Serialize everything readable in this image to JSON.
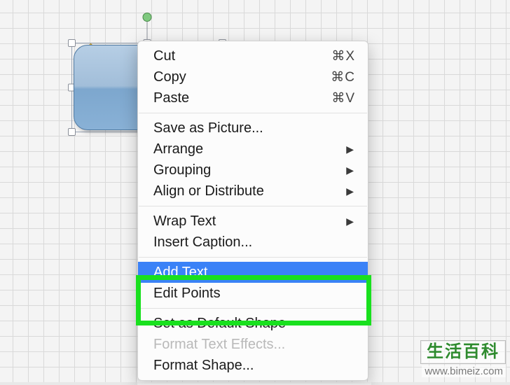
{
  "shape": {
    "type": "rounded-rectangle",
    "fill": "#8fb7db",
    "border": "#4f79a1",
    "selected": true
  },
  "menu": {
    "groups": [
      [
        {
          "key": "cut",
          "label": "Cut",
          "shortcut": "⌘X"
        },
        {
          "key": "copy",
          "label": "Copy",
          "shortcut": "⌘C"
        },
        {
          "key": "paste",
          "label": "Paste",
          "shortcut": "⌘V"
        }
      ],
      [
        {
          "key": "save_as_picture",
          "label": "Save as Picture..."
        },
        {
          "key": "arrange",
          "label": "Arrange",
          "submenu": true
        },
        {
          "key": "grouping",
          "label": "Grouping",
          "submenu": true
        },
        {
          "key": "align",
          "label": "Align or Distribute",
          "submenu": true
        }
      ],
      [
        {
          "key": "wrap_text",
          "label": "Wrap Text",
          "submenu": true
        },
        {
          "key": "insert_caption",
          "label": "Insert Caption..."
        }
      ],
      [
        {
          "key": "add_text",
          "label": "Add Text",
          "selected": true
        },
        {
          "key": "edit_points",
          "label": "Edit Points"
        }
      ],
      [
        {
          "key": "set_default",
          "label": "Set as Default Shape"
        },
        {
          "key": "format_text",
          "label": "Format Text Effects...",
          "disabled": true
        },
        {
          "key": "format_shape",
          "label": "Format Shape..."
        }
      ]
    ]
  },
  "watermark": {
    "brand": "生活百科",
    "url": "www.bimeiz.com"
  }
}
